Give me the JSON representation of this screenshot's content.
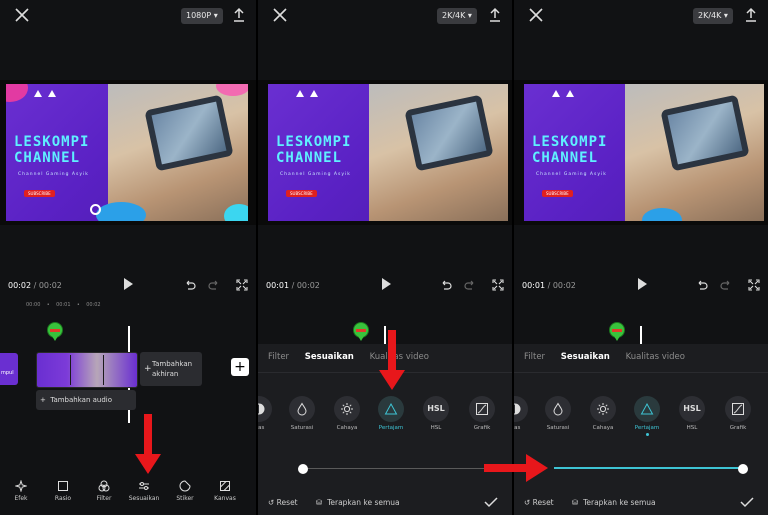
{
  "panels": [
    {
      "resolution": "1080P",
      "time_current": "00:02",
      "time_total": "00:02"
    },
    {
      "resolution": "2K/4K",
      "time_current": "00:01",
      "time_total": "00:02"
    },
    {
      "resolution": "2K/4K",
      "time_current": "00:01",
      "time_total": "00:02"
    }
  ],
  "thumbnail": {
    "brand_line1": "LESKOMPI",
    "brand_line2": "CHANNEL",
    "subtitle": "Channel Gaming Asyik",
    "subscribe": "SUBSCRIBE"
  },
  "timeline": {
    "ruler": [
      "00:00",
      "•",
      "00:01",
      "•",
      "00:02"
    ],
    "side_clip_label": "mpul",
    "add_end_line1": "Tambahkan",
    "add_end_line2": "akhiran",
    "add_audio": "Tambahkan audio",
    "add_plus": "+"
  },
  "toolbar": {
    "items": [
      {
        "label": "Efek",
        "icon": "effect-icon"
      },
      {
        "label": "Rasio",
        "icon": "ratio-icon"
      },
      {
        "label": "Filter",
        "icon": "filter-icon"
      },
      {
        "label": "Sesuaikan",
        "icon": "adjust-icon"
      },
      {
        "label": "Stiker",
        "icon": "sticker-icon"
      },
      {
        "label": "Kanvas",
        "icon": "canvas-icon"
      }
    ]
  },
  "adjust": {
    "tabs": [
      "Filter",
      "Sesuaikan",
      "Kualitas video"
    ],
    "active_tab": "Sesuaikan",
    "options_p2": [
      "tras",
      "Saturasi",
      "Cahaya",
      "Pertajam",
      "HSL",
      "Grafik"
    ],
    "options_p3": [
      "tras",
      "Saturasi",
      "Cahaya",
      "Pertajam",
      "HSL",
      "Grafik"
    ],
    "selected": "Pertajam",
    "hsl_glyph": "HSL",
    "reset_label": "Reset",
    "apply_all_label": "Terapkan ke semua",
    "slider_p2": 0.0,
    "slider_p3": 1.0
  },
  "colors": {
    "accent": "#3ec4d4",
    "arrow": "#e8171b",
    "pin": "#39c23c"
  }
}
